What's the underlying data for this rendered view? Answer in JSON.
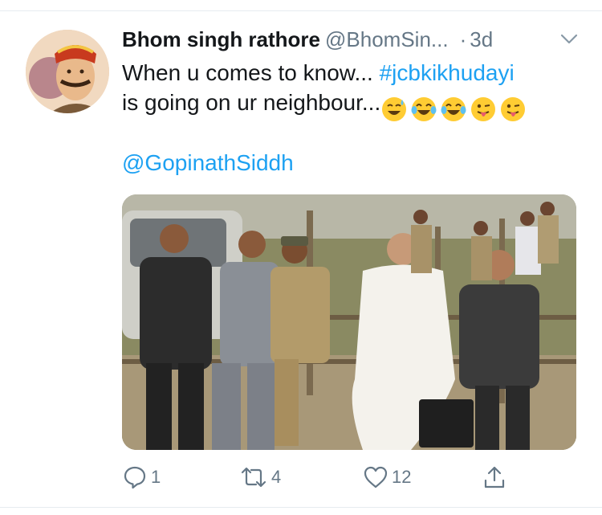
{
  "tweet": {
    "author_name": "Bhom singh rathore",
    "author_handle": "@BhomSin...",
    "dot": "·",
    "time": "3d",
    "text_line1": "When u comes to know...",
    "hashtag": "#jcbkikhudayi",
    "text_line2": "is going on ur neighbour...",
    "emojis": [
      "sweat-smile-emoji",
      "tears-of-joy-emoji",
      "tears-of-joy-emoji",
      "tongue-out-emoji",
      "tongue-out-emoji"
    ],
    "mention": "@GopinathSiddh"
  },
  "actions": {
    "replies": "1",
    "retweets": "4",
    "likes": "12"
  },
  "colors": {
    "link": "#1da1f2",
    "secondary_text": "#657786",
    "divider": "#e6ecf0"
  }
}
